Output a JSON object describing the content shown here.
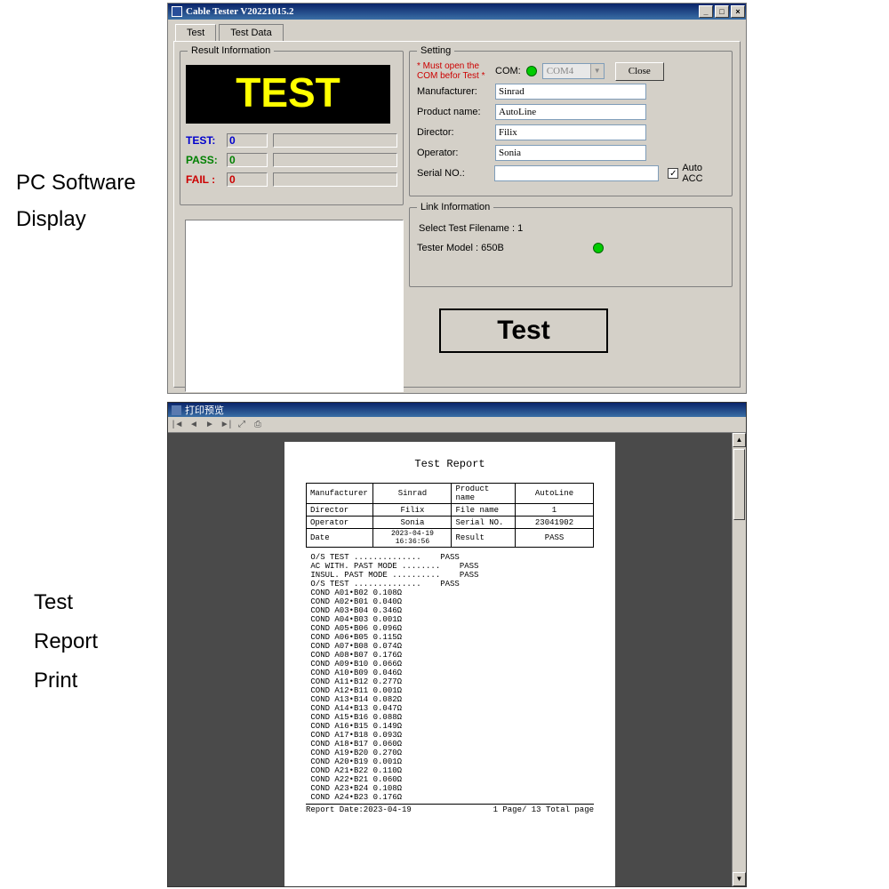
{
  "captions": {
    "line1": "PC Software",
    "line2": "Display",
    "line3": "Test",
    "line4": "Report",
    "line5": "Print"
  },
  "app": {
    "title": "Cable Tester V20221015.2",
    "tabs": {
      "test": "Test",
      "testdata": "Test Data"
    },
    "groups": {
      "result": "Result Information",
      "setting": "Setting",
      "link": "Link Information"
    },
    "display_text": "TEST",
    "counters": {
      "test_label": "TEST:",
      "test_val": "0",
      "pass_label": "PASS:",
      "pass_val": "0",
      "fail_label": "FAIL :",
      "fail_val": "0"
    },
    "setting": {
      "warn": "* Must open the COM befor Test *",
      "com_label": "COM:",
      "com_value": "COM4",
      "close_btn": "Close",
      "manufacturer_label": "Manufacturer:",
      "manufacturer": "Sinrad",
      "product_label": "Product name:",
      "product": "AutoLine",
      "director_label": "Director:",
      "director": "Filix",
      "operator_label": "Operator:",
      "operator": "Sonia",
      "serial_label": "Serial NO.:",
      "serial": "",
      "autoacc_label": "Auto ACC"
    },
    "link": {
      "file": "Select Test Filename : 1",
      "model": "Tester Model : 650B"
    },
    "test_btn": "Test",
    "winbtns": {
      "min": "_",
      "max": "□",
      "close": "×"
    }
  },
  "preview": {
    "title": "打印预览",
    "toolbar": {
      "first": "|◄",
      "prev": "◄",
      "next": "►",
      "last": "►|",
      "zoom": "⤢",
      "print": "⎙"
    },
    "report": {
      "title": "Test Report",
      "header": {
        "mfr_l": "Manufacturer",
        "mfr": "Sinrad",
        "prod_l": "Product name",
        "prod": "AutoLine",
        "dir_l": "Director",
        "dir": "Filix",
        "file_l": "File name",
        "file": "1",
        "op_l": "Operator",
        "op": "Sonia",
        "ser_l": "Serial NO.",
        "ser": "23041902",
        "date_l": "Date",
        "date": "2023-04-19 16:36:56",
        "res_l": "Result",
        "res": "PASS"
      },
      "lines": [
        "O/S TEST ..............    PASS",
        "AC WITH. PAST MODE ........    PASS",
        "INSUL. PAST MODE ..........    PASS",
        "O/S TEST ..............    PASS",
        "COND A01•B02 0.108Ω",
        "COND A02•B01 0.040Ω",
        "COND A03•B04 0.346Ω",
        "COND A04•B03 0.001Ω",
        "COND A05•B06 0.096Ω",
        "COND A06•B05 0.115Ω",
        "COND A07•B08 0.074Ω",
        "COND A08•B07 0.176Ω",
        "COND A09•B10 0.066Ω",
        "COND A10•B09 0.046Ω",
        "COND A11•B12 0.277Ω",
        "COND A12•B11 0.001Ω",
        "COND A13•B14 0.082Ω",
        "COND A14•B13 0.047Ω",
        "COND A15•B16 0.088Ω",
        "COND A16•B15 0.149Ω",
        "COND A17•B18 0.093Ω",
        "COND A18•B17 0.060Ω",
        "COND A19•B20 0.270Ω",
        "COND A20•B19 0.001Ω",
        "COND A21•B22 0.110Ω",
        "COND A22•B21 0.060Ω",
        "COND A23•B24 0.108Ω",
        "COND A24•B23 0.176Ω"
      ],
      "footer_left": "Report Date:2023-04-19",
      "footer_right": "1 Page/ 13 Total page"
    }
  }
}
